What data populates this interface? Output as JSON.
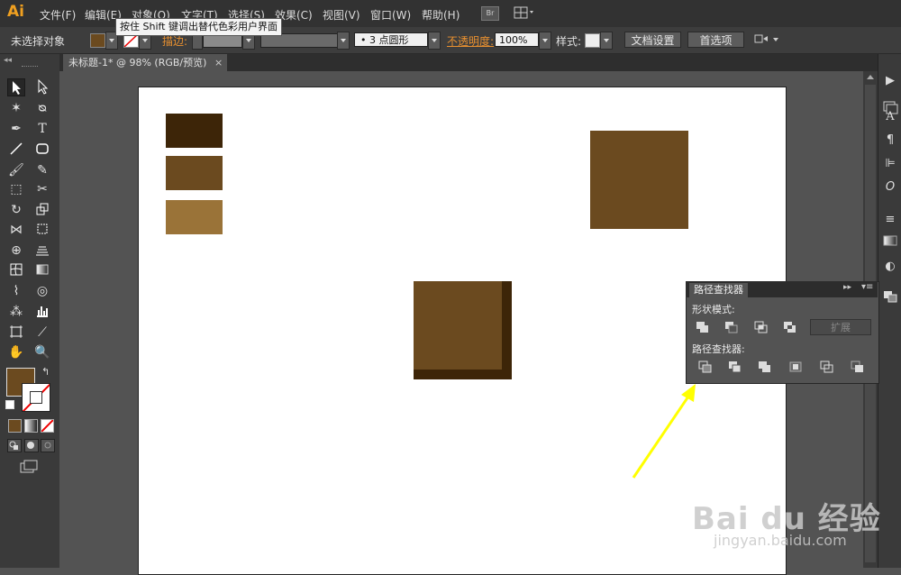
{
  "app": {
    "logo": "Ai"
  },
  "menu": [
    "文件(F)",
    "编辑(E)",
    "对象(O)",
    "文字(T)",
    "选择(S)",
    "效果(C)",
    "视图(V)",
    "窗口(W)",
    "帮助(H)"
  ],
  "bridge_label": "Br",
  "tooltip": "按住 Shift 键调出替代色彩用户界面",
  "control": {
    "selection": "未选择对象",
    "stroke_label": "描边:",
    "brush_value": "3 点圆形",
    "opacity_label": "不透明度:",
    "opacity_value": "100%",
    "style_label": "样式:",
    "doc_setup": "文档设置",
    "preferences": "首选项"
  },
  "document": {
    "tab": "未标题-1* @ 98% (RGB/预览)",
    "close": "×"
  },
  "colors": {
    "dark_brown": "#3d2508",
    "brown": "#6b4a1f",
    "light_brown": "#9a7338",
    "fill": "#6b4a1f",
    "accent_orange": "#e89030",
    "arrow": "#ffff00"
  },
  "pathfinder": {
    "title": "路径查找器",
    "shape_modes": "形状模式:",
    "pathfinders": "路径查找器:",
    "expand": "扩展"
  },
  "watermark": {
    "main": "Bai du 经验",
    "sub": "jingyan.baidu.com"
  }
}
